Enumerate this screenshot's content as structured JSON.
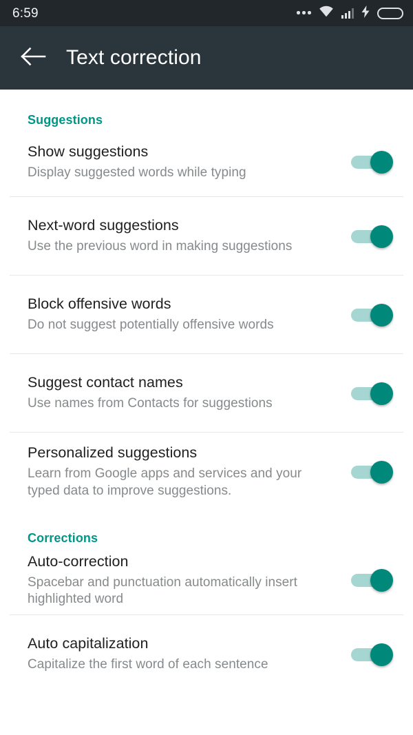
{
  "status_bar": {
    "time": "6:59",
    "icons": [
      {
        "name": "more-dots-icon"
      },
      {
        "name": "wifi-icon"
      },
      {
        "name": "cellular-signal-icon"
      },
      {
        "name": "charging-bolt-icon"
      },
      {
        "name": "battery-icon"
      }
    ]
  },
  "app_bar": {
    "back_label": "back-arrow",
    "title": "Text correction"
  },
  "colors": {
    "accent": "#009688",
    "switch_track_on": "#a6d6d1",
    "switch_thumb_on": "#00897b",
    "app_bar_bg": "#2b363c",
    "status_bar_bg": "#22272b",
    "battery_fill": "#3fd122",
    "title_text": "#1f1f1f",
    "subtitle_text": "#868a8c",
    "divider": "#e6e7e8"
  },
  "sections": [
    {
      "header": "Suggestions",
      "rows": [
        {
          "title": "Show suggestions",
          "subtitle": "Display suggested words while typing",
          "switch_state": "on"
        },
        {
          "title": "Next-word suggestions",
          "subtitle": "Use the previous word in making suggestions",
          "switch_state": "on"
        },
        {
          "title": "Block offensive words",
          "subtitle": "Do not suggest potentially offensive words",
          "switch_state": "on"
        },
        {
          "title": "Suggest contact names",
          "subtitle": "Use names from Contacts for suggestions",
          "switch_state": "on"
        },
        {
          "title": "Personalized suggestions",
          "subtitle": "Learn from Google apps and services and your typed data to improve suggestions.",
          "switch_state": "on"
        }
      ]
    },
    {
      "header": "Corrections",
      "rows": [
        {
          "title": "Auto-correction",
          "subtitle": "Spacebar and punctuation automatically insert highlighted word",
          "switch_state": "on"
        },
        {
          "title": "Auto capitalization",
          "subtitle": "Capitalize the first word of each sentence",
          "switch_state": "on"
        }
      ]
    }
  ]
}
